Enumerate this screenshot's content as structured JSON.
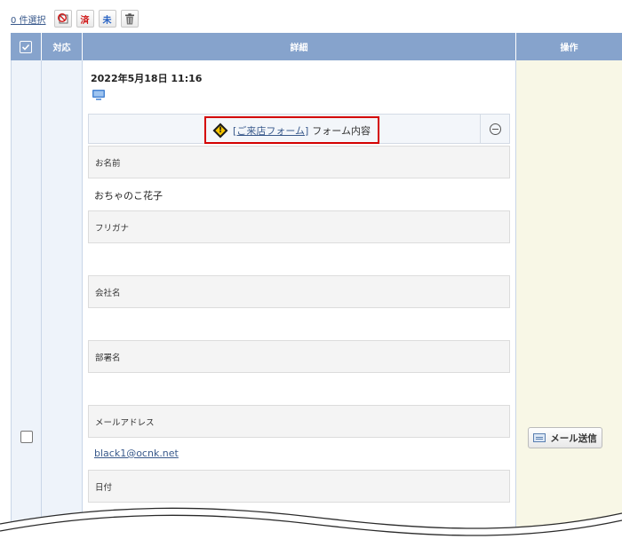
{
  "toolbar": {
    "selected_count": "0 件選択",
    "mark_done_label": "済",
    "mark_undone_label": "未"
  },
  "table": {
    "columns": [
      "対応",
      "詳細",
      "操作"
    ]
  },
  "entry": {
    "datetime": "2022年5月18日 11:16",
    "form_link": "[ご来店フォーム]",
    "form_suffix": "フォーム内容",
    "fields": [
      {
        "label": "お名前",
        "value": "おちゃのこ花子"
      },
      {
        "label": "フリガナ",
        "value": ""
      },
      {
        "label": "会社名",
        "value": ""
      },
      {
        "label": "部署名",
        "value": ""
      },
      {
        "label": "メールアドレス",
        "value": "black1@ocnk.net"
      },
      {
        "label": "日付",
        "value": ""
      }
    ]
  },
  "ops": {
    "send_mail_label": "メール送信"
  },
  "colors": {
    "header": "#86a3cc",
    "highlight_border": "#d40000",
    "link": "#3a5a8c",
    "ops_bg": "#f8f7e6"
  }
}
